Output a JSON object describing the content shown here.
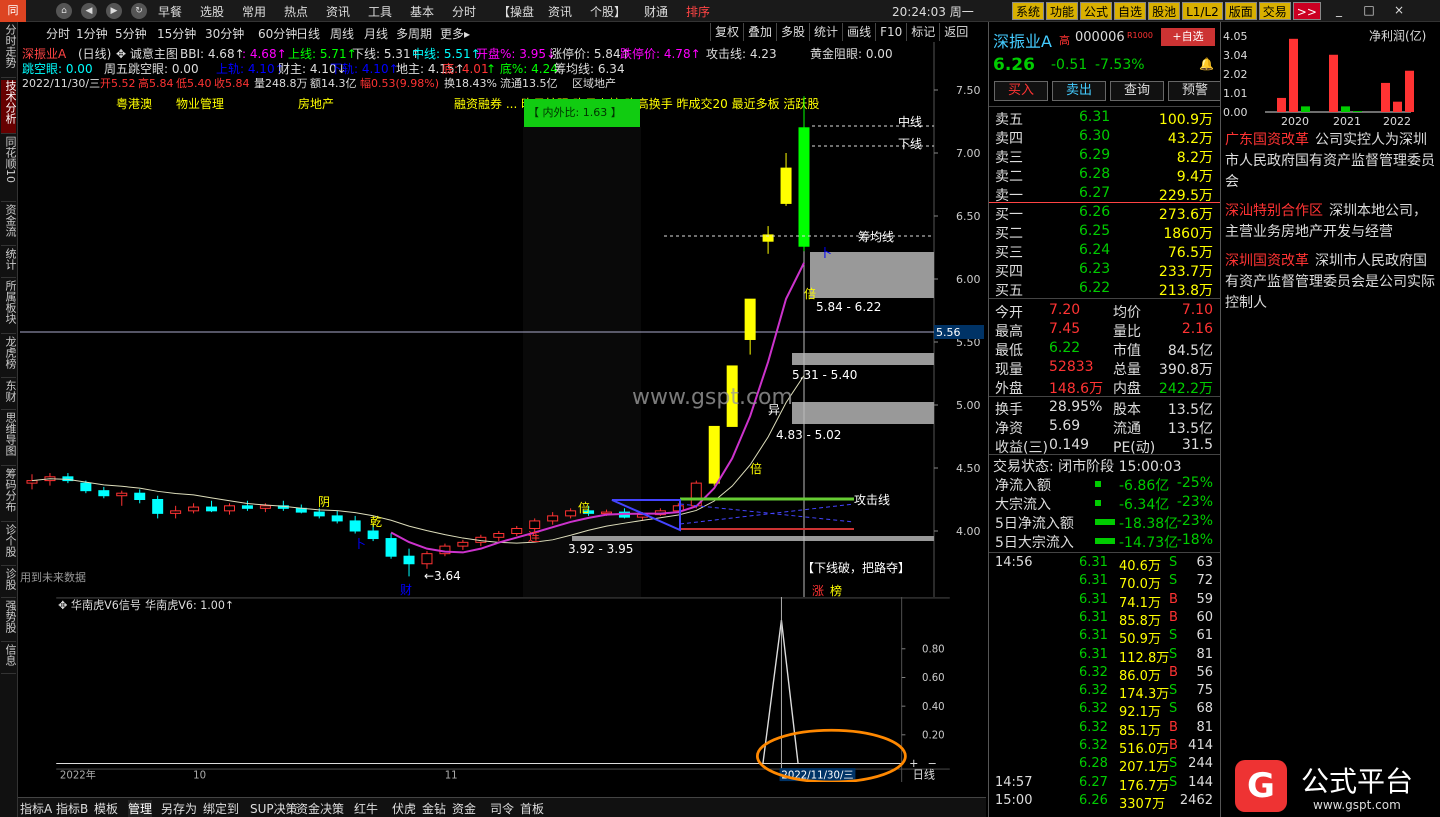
{
  "menubar": {
    "logo": "同",
    "items": [
      "早餐",
      "选股",
      "常用",
      "热点",
      "资讯",
      "工具",
      "基本",
      "分时",
      "【操盘",
      "资讯",
      "个股】",
      "财通",
      "排序"
    ],
    "clock": "20:24:03 周一",
    "tools": [
      "系统",
      "功能",
      "公式",
      "自选",
      "股池",
      "L1/L2",
      "版面",
      "交易",
      ">>"
    ],
    "win": [
      "_",
      "□",
      "×"
    ]
  },
  "leftbar": {
    "tabs": [
      "分时走势",
      "技术分析",
      "同花顺10",
      "资金流",
      "统计",
      "所属板块",
      "龙虎榜",
      "东财",
      "思维导图",
      "筹码分布",
      "诊个股",
      "诊股",
      "强势股",
      "信息"
    ],
    "active_index": 1
  },
  "periodbar": {
    "items": [
      "分时",
      "1分钟",
      "5分钟",
      "15分钟",
      "30分钟",
      "60分钟",
      "日线",
      "周线",
      "月线",
      "多周期",
      "更多▸"
    ],
    "right_tools": [
      "复权",
      "叠加",
      "多股",
      "统计",
      "画线",
      "F10",
      "标记",
      "返回"
    ]
  },
  "main": {
    "info_line1": [
      {
        "t": "深振业A",
        "c": "#f44"
      },
      {
        "t": "(日线)",
        "c": "#ddd"
      },
      {
        "t": "✥ 诚意主图",
        "c": "#ddd"
      },
      {
        "t": "BBI: 4.68↑",
        "c": "#ddd"
      },
      {
        "t": ": 4.68↑",
        "c": "#f0f"
      },
      {
        "t": "上线: 5.71↑",
        "c": "#0f0"
      },
      {
        "t": "下线: 5.31↑",
        "c": "#ddd"
      },
      {
        "t": "中线: 5.51↑",
        "c": "#0ff"
      },
      {
        "t": "开盘%: 3.95↓",
        "c": "#f0f"
      },
      {
        "t": "涨停价: 5.84↑",
        "c": "#ddd"
      },
      {
        "t": "跌停价: 4.78↑",
        "c": "#f0f"
      },
      {
        "t": "攻击线: 4.23",
        "c": "#ddd"
      },
      {
        "t": "黄金阻眼: 0.00",
        "c": "#ddd"
      }
    ],
    "info_line2": [
      {
        "t": "跳空眼: 0.00",
        "c": "#0ff"
      },
      {
        "t": "周五跳空眼: 0.00",
        "c": "#ddd"
      },
      {
        "t": "上轨: 4.10↑",
        "c": "#00f"
      },
      {
        "t": "财主: 4.10↓",
        "c": "#ddd"
      },
      {
        "t": "下轨: 4.10↑",
        "c": "#00f"
      },
      {
        "t": "地主: 4.15↑",
        "c": "#ddd"
      },
      {
        "t": "底: 4.01",
        "c": "#f33"
      },
      {
        "t": "↑ 底%: 4.24",
        "c": "#0f0"
      },
      {
        "t": "筹均线: 6.34",
        "c": "#ddd"
      }
    ],
    "info_line3": [
      {
        "t": "2022/11/30/三",
        "c": "#ddd"
      },
      {
        "t": "开5.52",
        "c": "#f33"
      },
      {
        "t": "高5.84",
        "c": "#f33"
      },
      {
        "t": "低5.40",
        "c": "#f33"
      },
      {
        "t": "收5.84",
        "c": "#f33"
      },
      {
        "t": "量248.8万",
        "c": "#ddd"
      },
      {
        "t": "额14.3亿",
        "c": "#ddd"
      },
      {
        "t": "幅0.53(9.98%)",
        "c": "#f33"
      },
      {
        "t": "换18.43%",
        "c": "#ddd"
      },
      {
        "t": "流通13.5亿",
        "c": "#ddd"
      },
      {
        "t": "区域地产",
        "c": "#ddd"
      }
    ],
    "concepts": [
      "粤港澳",
      "物业管理",
      "房地产"
    ],
    "concept_tail": "融资融券 ... 昨日较强 昨日上榜 昨高换手 昨成交20 最近多板 活跃股",
    "ratio_badge": "【 内外比: 1.63 】",
    "watermark": "www.gspt.com",
    "y_ticks": [
      "7.50",
      "7.00",
      "6.50",
      "6.00",
      "5.50",
      "5.00",
      "4.50",
      "4.00"
    ],
    "price_tag": "5.56",
    "labels": {
      "zhongxian": "中线",
      "xiaxian": "下线",
      "choujun": "筹均线",
      "gongji": "攻击线",
      "range1": "5.84 - 6.22",
      "range2": "5.31 - 5.40",
      "range3": "4.83 - 5.02",
      "range4": "3.92 - 3.95",
      "low": "←3.64",
      "break": "【下线破，把路夺】",
      "future": "用到未来数据",
      "zhang": "涨",
      "bang": "榜",
      "bei": "倍",
      "yi": "异",
      "xia": "卜",
      "cai": "财",
      "yin": "阴",
      "gan": "乾",
      "lian": "连",
      "bang2": "榜"
    }
  },
  "indicator": {
    "title": "✥ 华南虎V6信号",
    "value_label": "华南虎V6: 1.00↑",
    "y_ticks": [
      "0.80",
      "0.60",
      "0.40",
      "0.20"
    ],
    "x_labels": [
      "2022年",
      "10",
      "11"
    ],
    "date_tag": "2022/11/30/三",
    "period": "日线",
    "plus": "+",
    "minus": "−"
  },
  "bottomtabs": [
    "指标A",
    "指标B",
    "模板",
    "管理",
    "另存为",
    "绑定到",
    "SUP决策",
    "资金决策",
    "红牛",
    "伏虎",
    "金钻",
    "资金",
    "司令",
    "首板"
  ],
  "quote": {
    "name": "深振业A",
    "name_suffix": "高",
    "code": "000006",
    "code_badge": "R1000",
    "add_btn": "+自选",
    "price": "6.26",
    "change": "-0.51",
    "pct": "-7.53%",
    "actions": [
      "买入",
      "卖出",
      "查询",
      "预警"
    ],
    "asks": [
      {
        "l": "卖五",
        "p": "6.31",
        "v": "100.9万",
        "pc": "y"
      },
      {
        "l": "卖四",
        "p": "6.30",
        "v": "43.2万",
        "pc": "y"
      },
      {
        "l": "卖三",
        "p": "6.29",
        "v": "8.2万",
        "pc": "y"
      },
      {
        "l": "卖二",
        "p": "6.28",
        "v": "9.4万",
        "pc": "y"
      },
      {
        "l": "卖一",
        "p": "6.27",
        "v": "229.5万",
        "pc": "y"
      }
    ],
    "bids": [
      {
        "l": "买一",
        "p": "6.26",
        "v": "273.6万"
      },
      {
        "l": "买二",
        "p": "6.25",
        "v": "1860万"
      },
      {
        "l": "买三",
        "p": "6.24",
        "v": "76.5万"
      },
      {
        "l": "买四",
        "p": "6.23",
        "v": "233.7万"
      },
      {
        "l": "买五",
        "p": "6.22",
        "v": "213.8万"
      }
    ],
    "stats": [
      {
        "l1": "今开",
        "v1": "7.20",
        "c1": "r",
        "l2": "均价",
        "v2": "7.10",
        "c2": "r"
      },
      {
        "l1": "最高",
        "v1": "7.45",
        "c1": "r",
        "l2": "量比",
        "v2": "2.16",
        "c2": "r"
      },
      {
        "l1": "最低",
        "v1": "6.22",
        "c1": "g",
        "l2": "市值",
        "v2": "84.5亿",
        "c2": "w"
      },
      {
        "l1": "现量",
        "v1": "52833",
        "c1": "r",
        "l2": "总量",
        "v2": "390.8万",
        "c2": "w"
      },
      {
        "l1": "外盘",
        "v1": "148.6万",
        "c1": "r",
        "l2": "内盘",
        "v2": "242.2万",
        "c2": "g"
      }
    ],
    "stats2": [
      {
        "l1": "换手",
        "v1": "28.95%",
        "l2": "股本",
        "v2": "13.5亿"
      },
      {
        "l1": "净资",
        "v1": "5.69",
        "l2": "流通",
        "v2": "13.5亿"
      },
      {
        "l1": "收益(三)",
        "v1": "0.149",
        "l2": "PE(动)",
        "v2": "31.5"
      }
    ],
    "trade_state": "交易状态: 闭市阶段 15:00:03",
    "flows": [
      {
        "l": "净流入额",
        "v": "-6.86亿",
        "p": "-25%"
      },
      {
        "l": "大宗流入",
        "v": "-6.34亿",
        "p": "-23%"
      },
      {
        "l": "5日净流入额",
        "v": "-18.38亿",
        "p": "-23%"
      },
      {
        "l": "5日大宗流入",
        "v": "-14.73亿",
        "p": "-18%"
      }
    ],
    "ticks": [
      {
        "t": "14:56",
        "p": "6.31",
        "v": "40.6万",
        "s": "S",
        "n": "63"
      },
      {
        "t": "",
        "p": "6.31",
        "v": "70.0万",
        "s": "S",
        "n": "72"
      },
      {
        "t": "",
        "p": "6.31",
        "v": "74.1万",
        "s": "B",
        "n": "59"
      },
      {
        "t": "",
        "p": "6.31",
        "v": "85.8万",
        "s": "B",
        "n": "60"
      },
      {
        "t": "",
        "p": "6.31",
        "v": "50.9万",
        "s": "S",
        "n": "61"
      },
      {
        "t": "",
        "p": "6.31",
        "v": "112.8万",
        "s": "S",
        "n": "81"
      },
      {
        "t": "",
        "p": "6.32",
        "v": "86.0万",
        "s": "B",
        "n": "56"
      },
      {
        "t": "",
        "p": "6.32",
        "v": "174.3万",
        "s": "S",
        "n": "75"
      },
      {
        "t": "",
        "p": "6.32",
        "v": "92.1万",
        "s": "S",
        "n": "68"
      },
      {
        "t": "",
        "p": "6.32",
        "v": "85.1万",
        "s": "B",
        "n": "81"
      },
      {
        "t": "",
        "p": "6.32",
        "v": "516.0万",
        "s": "B",
        "n": "414"
      },
      {
        "t": "",
        "p": "6.28",
        "v": "207.1万",
        "s": "S",
        "n": "244"
      },
      {
        "t": "14:57",
        "p": "6.27",
        "v": "176.7万",
        "s": "S",
        "n": "144"
      },
      {
        "t": "15:00",
        "p": "6.26",
        "v": "3307万",
        "s": "",
        "n": "2462"
      }
    ]
  },
  "rightpanel": {
    "chart_data": {
      "type": "bar",
      "title": "净利润(亿)",
      "categories": [
        "2020",
        "2021",
        "2022"
      ],
      "values": [
        0.75,
        3.9,
        0.3,
        3.05,
        0.3,
        0.05,
        1.55,
        0.55,
        2.2
      ],
      "ylim": [
        0,
        4.05
      ],
      "y_ticks": [
        "4.05",
        "3.04",
        "2.02",
        "1.01",
        "0.00"
      ],
      "colors": [
        "#f33",
        "#f33",
        "#0c0",
        "#f33",
        "#0c0",
        "#0c0",
        "#f33",
        "#f33",
        "#f33"
      ]
    },
    "tags": [
      {
        "tag": "广东国资改革",
        "text": "公司实控人为深圳市人民政府国有资产监督管理委员会"
      },
      {
        "tag": "深汕特别合作区",
        "text": "深圳本地公司，主营业务房地产开发与经营"
      },
      {
        "tag": "深圳国资改革",
        "text": "深圳市人民政府国有资产监督管理委员会是公司实际控制人"
      }
    ],
    "brand": "公式平台",
    "brand_url": "www.gspt.com"
  }
}
